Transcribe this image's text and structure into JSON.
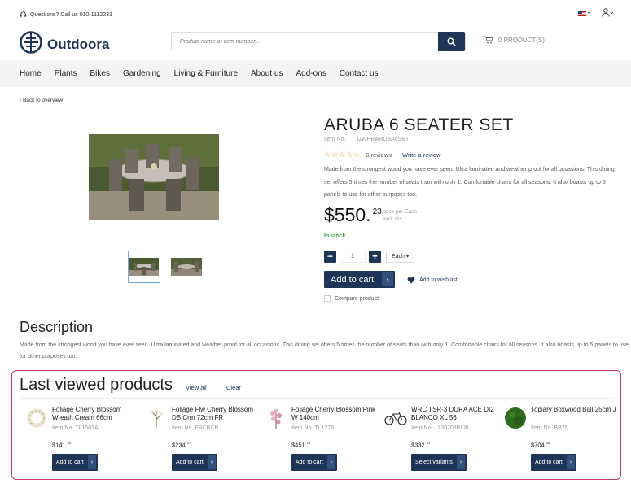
{
  "topbar": {
    "help_text": "Questions? Call us 010-1112233",
    "lang_icon": "us-flag-icon",
    "user_icon": "user-icon"
  },
  "header": {
    "logo_text": "Outdoora",
    "search_placeholder": "Product name or item number...",
    "cart_label": "0 PRODUCT(S)"
  },
  "nav": {
    "items": [
      "Home",
      "Plants",
      "Bikes",
      "Gardening",
      "Living & Furniture",
      "About us",
      "Add-ons",
      "Contact us"
    ]
  },
  "product": {
    "back_label": "‹ Back to overview",
    "title": "ARUBA 6 SEATER SET",
    "item_label": "Item No.",
    "item_no": "GWHRARUBA6SET",
    "stars": "☆☆☆☆☆",
    "reviews": "0 reviews",
    "write_review": "Write a review",
    "description": "Made from the strongest wood you have ever seen. Ultra laminated and weather proof for all occasions. This dining set offers 5 times the number of seats than with only 1. Comfortable chairs for all seasons. It also boasts up to 5 panels to use for other purposes too.",
    "price_main": "$550.",
    "price_cents": "23",
    "price_info_1": "price per Each",
    "price_info_2": "excl. tax",
    "stock": "In stock",
    "qty_minus": "−",
    "qty_value": "1",
    "qty_plus": "+",
    "unit": "Each ▾",
    "add_to_cart": "Add to cart",
    "wishlist": "Add to wish list",
    "compare": "Compare product"
  },
  "description_section": {
    "title": "Description",
    "text": "Made from the strongest wood you have ever seen. Ultra laminated and weather proof for all occasions. This dining set offers 5 times the number of seats than with only 1. Comfortable chairs for all seasons. It also boasts up to 5 panels to use for other purposes too."
  },
  "last_viewed": {
    "title": "Last viewed products",
    "view_all": "View all",
    "clear": "Clear",
    "items": [
      {
        "name": "Foliage Cherry Blossom Wreath Cream 66cm",
        "no": "Item No. TL1503A",
        "price": "$141.",
        "cents": "40",
        "button": "Add to cart"
      },
      {
        "name": "Foliage Flw Cherry Blossom DB Crm 72cm FR",
        "no": "Item No. FRCBCR",
        "price": "$234.",
        "cents": "27",
        "button": "Add to cart"
      },
      {
        "name": "Foliage Cherry Blossom Pink W 140cm",
        "no": "Item No. TL1278",
        "price": "$451.",
        "cents": "18",
        "button": "Add to cart"
      },
      {
        "name": "WRC TSR-3 DURA ACE DI2 BLANCO XL 56",
        "no": "Item No. ..730203BLXL",
        "price": "$332.",
        "cents": "91",
        "button": "Select variants"
      },
      {
        "name": "Topiary Boxwood Ball 25cm J",
        "no": "Item No. BB25",
        "price": "$704.",
        "cents": "35",
        "button": "Add to cart"
      }
    ]
  }
}
